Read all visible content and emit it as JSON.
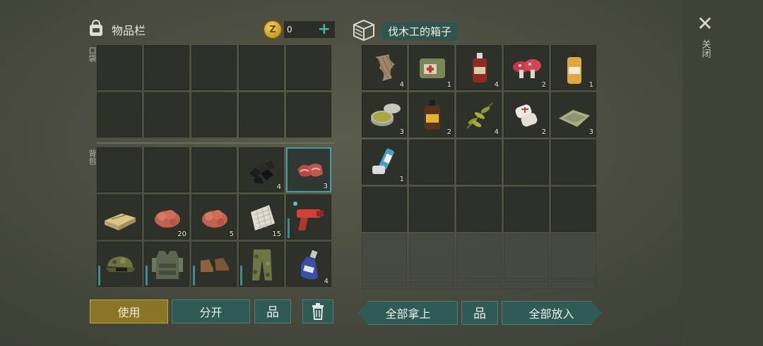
{
  "inventory": {
    "title": "物品栏",
    "coins": "0",
    "pocket_label": "口袋",
    "backpack_label": "背包",
    "backpack_items": [
      {
        "qty": ""
      },
      {
        "qty": ""
      },
      {
        "qty": ""
      },
      {
        "icon": "coal-icon",
        "qty": "4"
      },
      {
        "icon": "raw-meat-icon",
        "qty": "3"
      },
      {
        "icon": "ration-box-icon",
        "qty": ""
      },
      {
        "icon": "raw-meat-chunk-icon",
        "qty": "20"
      },
      {
        "icon": "raw-meat-chunk-icon",
        "qty": "5"
      },
      {
        "icon": "cloth-icon",
        "qty": "15"
      },
      {
        "icon": "flare-gun-icon",
        "qty": ""
      },
      {
        "icon": "camo-cap-icon",
        "qty": ""
      },
      {
        "icon": "tactical-vest-icon",
        "qty": ""
      },
      {
        "icon": "boots-icon",
        "qty": ""
      },
      {
        "icon": "camo-pants-icon",
        "qty": ""
      },
      {
        "icon": "blue-potion-icon",
        "qty": "4"
      }
    ]
  },
  "box": {
    "title": "伐木工的箱子",
    "items": [
      {
        "icon": "fiber-icon",
        "qty": "4"
      },
      {
        "icon": "first-aid-bag-icon",
        "qty": "1"
      },
      {
        "icon": "tincture-bottle-icon",
        "qty": "4"
      },
      {
        "icon": "red-mushroom-icon",
        "qty": "2"
      },
      {
        "icon": "oil-bottle-icon",
        "qty": "1"
      },
      {
        "icon": "ointment-tin-icon",
        "qty": "3"
      },
      {
        "icon": "iodine-bottle-icon",
        "qty": "2"
      },
      {
        "icon": "herb-icon",
        "qty": "4"
      },
      {
        "icon": "bandage-icon",
        "qty": "2"
      },
      {
        "icon": "cloth-rag-icon",
        "qty": "3"
      },
      {
        "icon": "inhaler-icon",
        "qty": "1"
      }
    ]
  },
  "close_label": "关闭",
  "buttons": {
    "use": "使用",
    "split": "分开",
    "sort_glyph": "品",
    "take_all": "全部拿上",
    "put_all": "全部放入"
  },
  "colors": {
    "accent_teal": "#2f5a55",
    "use_gold": "#8a7426",
    "selected_border": "#4a9ca0"
  }
}
